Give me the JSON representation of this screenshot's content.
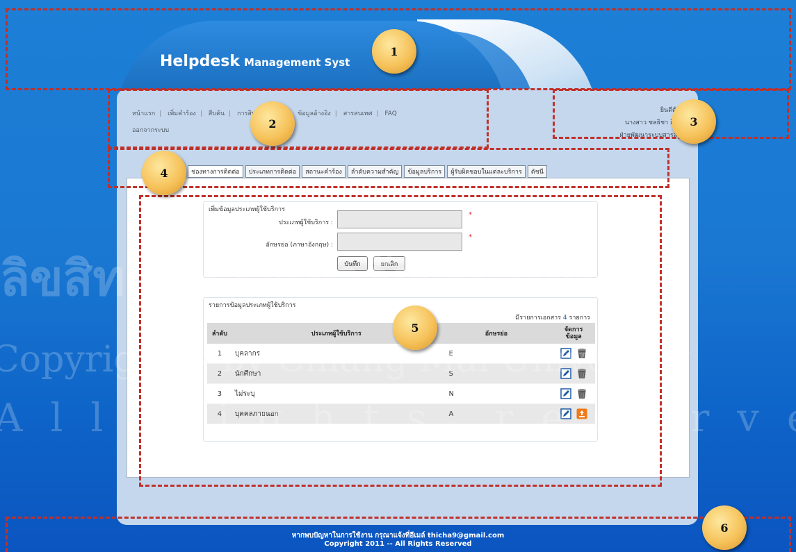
{
  "header": {
    "logo_main": "Helpdesk",
    "logo_sub": "Management Syst"
  },
  "nav": {
    "items": [
      "หน้าแรก",
      "เพิ่มคำร้อง",
      "สืบค้น",
      "การสิทธิ์ผู้ใช้ระบบ",
      "ข้อมูลอ้างอิง",
      "สารสนเทศ",
      "FAQ"
    ],
    "logout": "ออกจากระบบ",
    "separator": "|"
  },
  "user": {
    "welcome": "ยินดีต้อนรับ",
    "name": "นางสาว ชลธิชา ถิ่นทะเล",
    "dept": "ฝ่ายพัฒนาระบบสารสนเทศ"
  },
  "tabs": [
    "ช่องทางการติดต่อ",
    "ประเภทการติดต่อ",
    "สถานะคำร้อง",
    "ลำดับความสำคัญ",
    "ข้อมูลบริการ",
    "ผู้รับผิดชอบในแต่ละบริการ",
    "ดัชนี"
  ],
  "form": {
    "title": "เพิ่มข้อมูลประเภทผู้ใช้บริการ",
    "field1_label": "ประเภทผู้ใช้บริการ :",
    "field1_value": "",
    "field2_label": "อักษรย่อ (ภาษาอังกฤษ) :",
    "field2_value": "",
    "required_mark": "*",
    "save": "บันทึก",
    "cancel": "ยกเลิก"
  },
  "list": {
    "title": "รายการข้อมูลประเภทผู้ใช้บริการ",
    "count_prefix": "มีรายการเอกสาร",
    "count": "4",
    "count_suffix": "รายการ",
    "columns": {
      "no": "ลำดับ",
      "type": "ประเภทผู้ใช้บริการ",
      "abbr": "อักษรย่อ",
      "manage_line1": "จัดการ",
      "manage_line2": "ข้อมูล"
    },
    "rows": [
      {
        "no": "1",
        "type": "บุคลากร",
        "abbr": "E",
        "delete_icon": "trash-icon"
      },
      {
        "no": "2",
        "type": "นักศึกษา",
        "abbr": "S",
        "delete_icon": "trash-icon"
      },
      {
        "no": "3",
        "type": "ไม่ระบุ",
        "abbr": "N",
        "delete_icon": "trash-icon"
      },
      {
        "no": "4",
        "type": "บุคคลภายนอก",
        "abbr": "A",
        "delete_icon": "recycle-icon"
      }
    ]
  },
  "badges": [
    "1",
    "2",
    "3",
    "4",
    "5",
    "6"
  ],
  "footer": {
    "line1": "หากพบปัญหาในการใช้งาน กรุณาแจ้งที่อีเมล์ thicha9@gmail.com",
    "line2": "Copyright 2011 -- All Rights Reserved"
  },
  "watermark": {
    "line1": "ลิขสิทธิ์มหาวิทยาลัยเชียงใหม่",
    "line2": "Copyright© by Chiang Mai University",
    "line3": "All rights reserved"
  }
}
